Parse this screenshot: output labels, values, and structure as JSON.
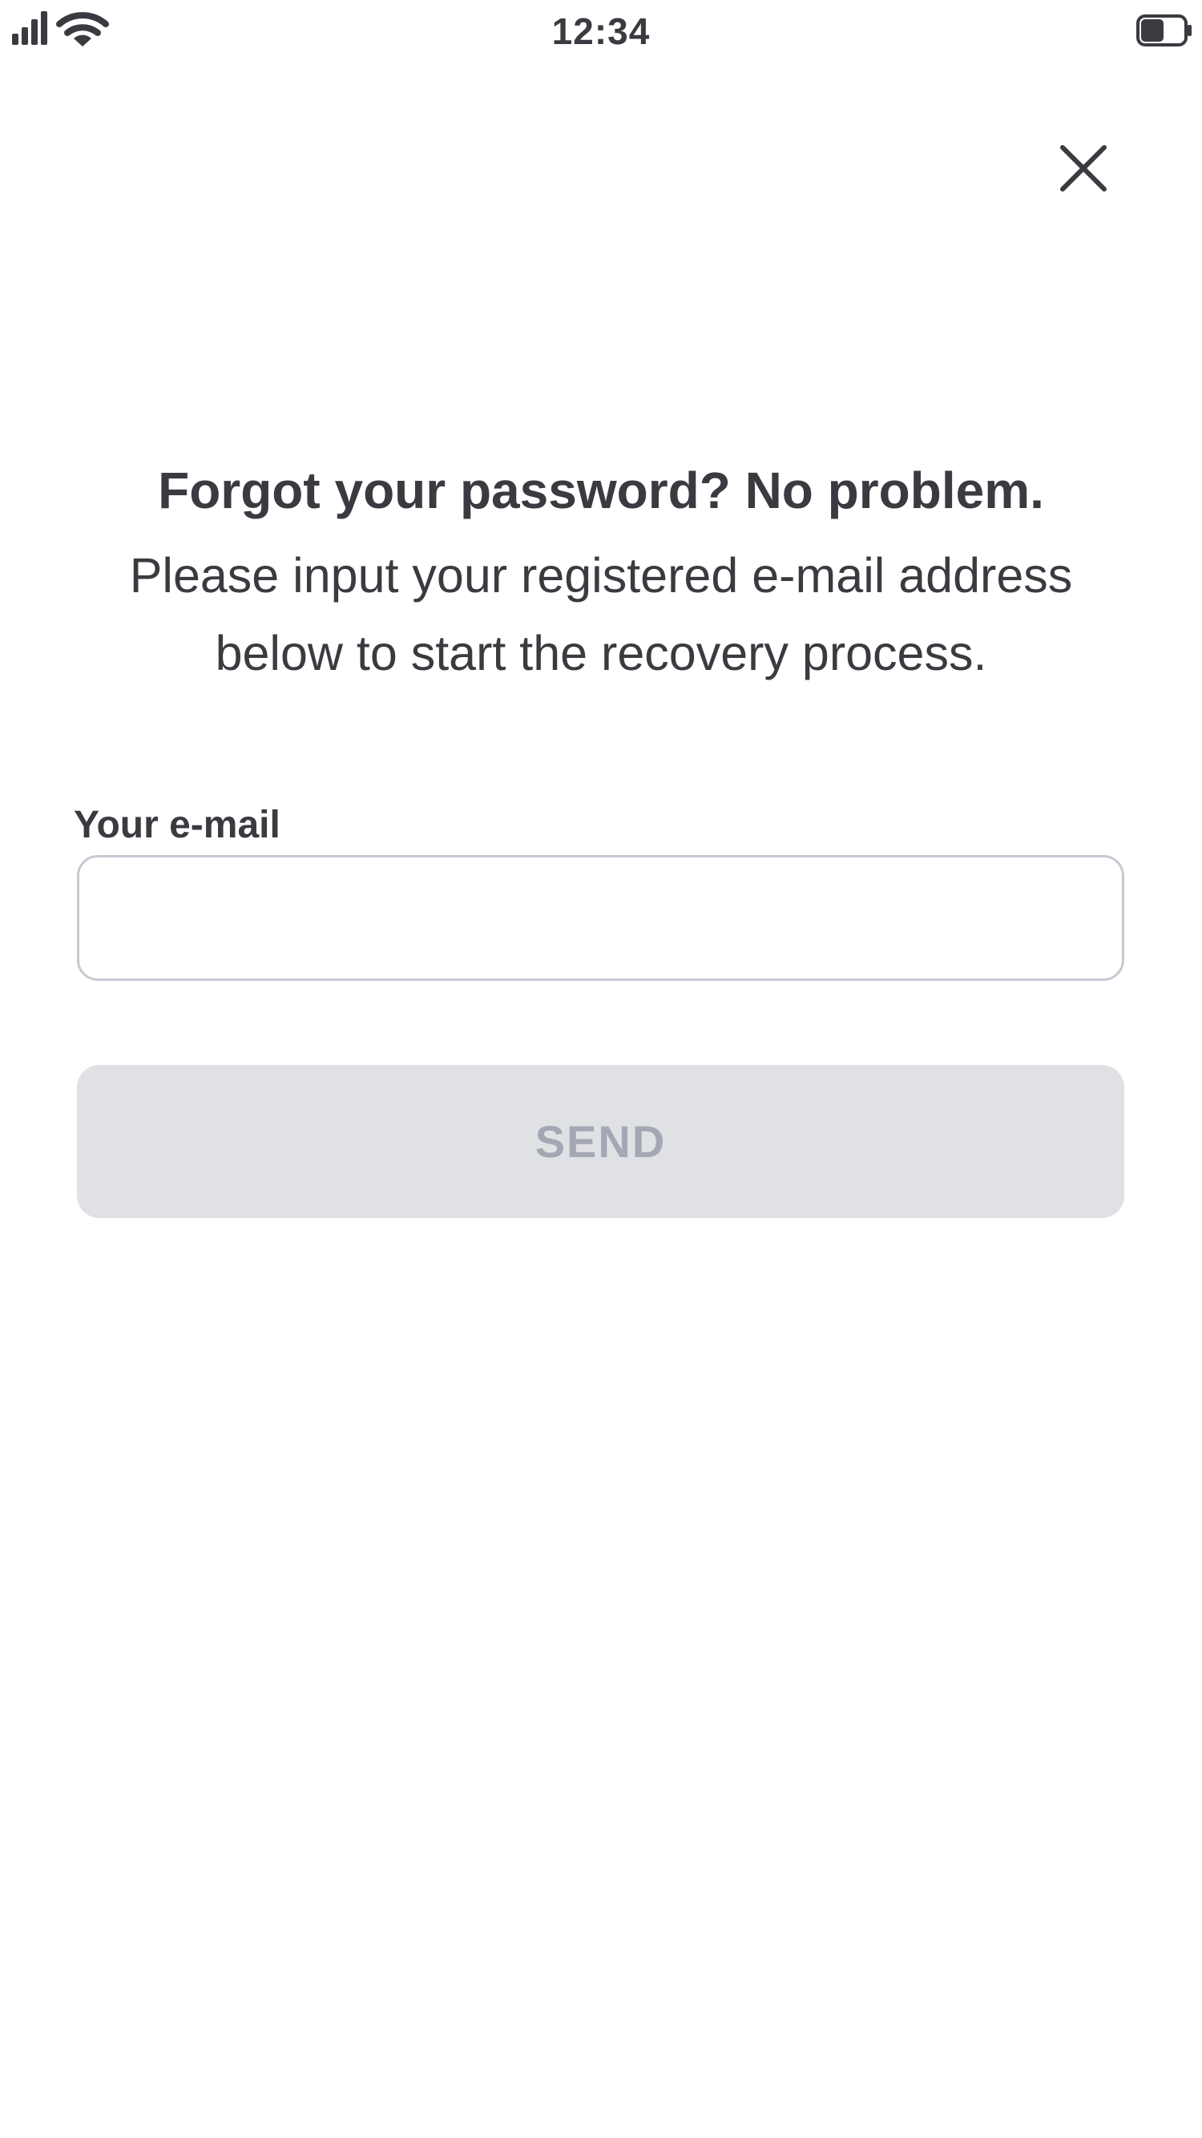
{
  "status_bar": {
    "time": "12:34",
    "icons": [
      "signal-icon",
      "wifi-icon",
      "battery-icon"
    ]
  },
  "header": {
    "close_icon": "close-icon"
  },
  "main": {
    "heading": "Forgot your password? No problem.",
    "description": "Please input your registered e-mail address below to start the recovery process."
  },
  "form": {
    "email_label": "Your e-mail",
    "email_value": "",
    "email_placeholder": "",
    "send_label": "SEND",
    "send_enabled": false
  },
  "colors": {
    "text": "#3a3a40",
    "input_border": "#c6c9d3",
    "button_disabled_bg": "#e0e1e5",
    "button_disabled_text": "#a4a8b4",
    "background": "#ffffff"
  }
}
